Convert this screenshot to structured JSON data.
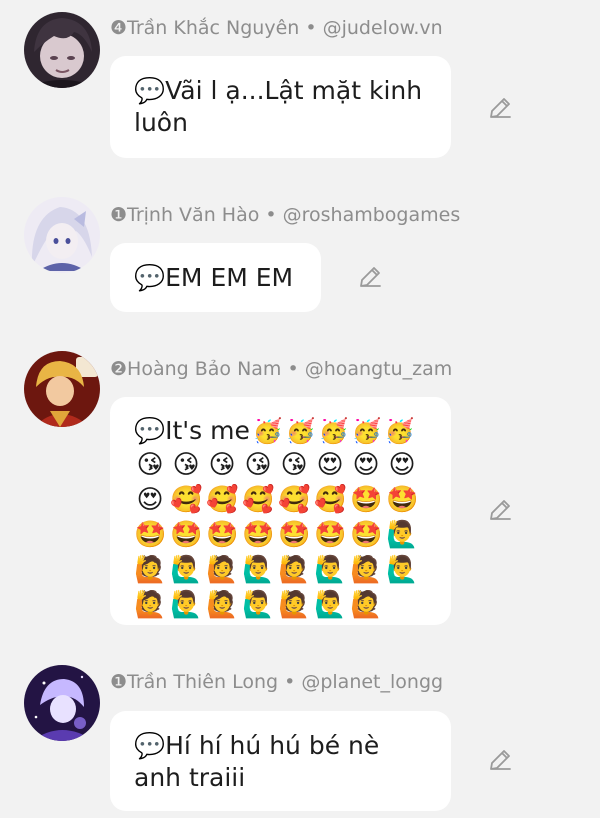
{
  "comments": [
    {
      "author": "❹Trần Khắc Nguyên • @judelow.vn",
      "text": "💬Vãi l ạ...Lật mặt kinh luôn",
      "avatar": "avatar-dark-haired-character",
      "colors": {
        "bg": "#3b2f3a",
        "accent": "#a48fb0"
      }
    },
    {
      "author": "❶Trịnh Văn Hào • @roshambogames",
      "text": "💬EM EM EM",
      "avatar": "avatar-white-haired-character",
      "colors": {
        "bg": "#e9e6f2",
        "accent": "#6a6fb2"
      }
    },
    {
      "author": "❷Hoàng Bảo Nam • @hoangtu_zam",
      "text": "💬It's me",
      "emojis": [
        "🥳",
        "🥳",
        "🥳",
        "🥳",
        "🥳",
        "😘",
        "😘",
        "😘",
        "😘",
        "😘",
        "😍",
        "😍",
        "😍",
        "😍",
        "🥰",
        "🥰",
        "🥰",
        "🥰",
        "🥰",
        "🤩",
        "🤩",
        "🤩",
        "🤩",
        "🤩",
        "🤩",
        "🤩",
        "🤩",
        "🤩",
        "🙋‍♂️",
        "🙋",
        "🙋‍♂️",
        "🙋",
        "🙋‍♂️",
        "🙋",
        "🙋‍♂️",
        "🙋",
        "🙋‍♂️",
        "🙋",
        "🙋‍♂️",
        "🙋",
        "🙋‍♂️",
        "🙋",
        "🙋‍♂️",
        "🙋"
      ],
      "avatar": "avatar-red-robed-character",
      "colors": {
        "bg": "#7a1c12",
        "accent": "#e7b34a"
      }
    },
    {
      "author": "❶Trần Thiên Long • @planet_longg",
      "text": "💬Hí hí hú hú bé nè anh traiii",
      "avatar": "avatar-purple-galaxy-character",
      "colors": {
        "bg": "#2b1b55",
        "accent": "#b9a4ff"
      }
    }
  ],
  "icons": {
    "edit": "pencil-edit-icon"
  },
  "colors": {
    "background": "#f2f2f2",
    "bubble": "#ffffff",
    "meta_text": "#8d8d8d",
    "body_text": "#1d1d1d",
    "icon": "#9a9a9a"
  }
}
